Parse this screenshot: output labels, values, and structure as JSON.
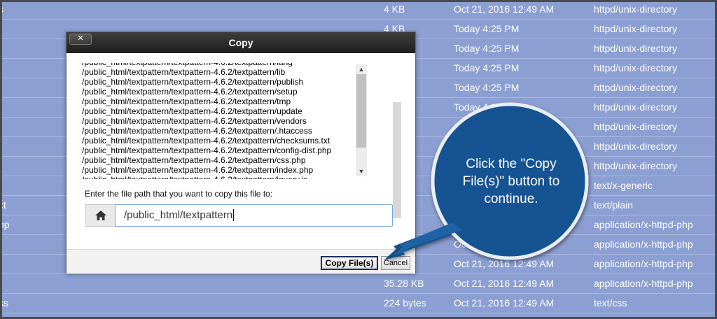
{
  "file_table": {
    "rows": [
      {
        "name": "s",
        "size": "4 KB",
        "date": "Oct 21, 2016 12:49 AM",
        "type": "httpd/unix-directory"
      },
      {
        "name": "",
        "size": "4 KB",
        "date": "Today 4:25 PM",
        "type": "httpd/unix-directory"
      },
      {
        "name": "",
        "size": "",
        "date": "Today 4:25 PM",
        "type": "httpd/unix-directory"
      },
      {
        "name": "",
        "size": "",
        "date": "Today 4:25 PM",
        "type": "httpd/unix-directory"
      },
      {
        "name": "",
        "size": "",
        "date": "Today 4:25 PM",
        "type": "httpd/unix-directory"
      },
      {
        "name": "",
        "size": "",
        "date": "Today 4:25 PM",
        "type": "httpd/unix-directory"
      },
      {
        "name": "",
        "size": "",
        "date": "Oct",
        "type": "httpd/unix-directory"
      },
      {
        "name": "",
        "size": "",
        "date": "",
        "type": "httpd/unix-directory"
      },
      {
        "name": "",
        "size": "",
        "date": "",
        "type": "httpd/unix-directory"
      },
      {
        "name": "",
        "size": "ytes",
        "date": "",
        "type": "text/x-generic"
      },
      {
        "name": "xt",
        "size": "",
        "date": "",
        "type": "text/plain"
      },
      {
        "name": "hp",
        "size": "B",
        "date": "",
        "type": "application/x-httpd-php"
      },
      {
        "name": "",
        "size": "",
        "date": "Oc",
        "type": "application/x-httpd-php"
      },
      {
        "name": "",
        "size": "B",
        "date": "Oct 21, 2016 12:49 AM",
        "type": "application/x-httpd-php"
      },
      {
        "name": "",
        "size": "35.28 KB",
        "date": "Oct 21, 2016 12:49 AM",
        "type": "application/x-httpd-php"
      },
      {
        "name": "ss",
        "size": "224 bytes",
        "date": "Oct 21, 2016 12:49 AM",
        "type": "text/css"
      }
    ]
  },
  "dialog": {
    "title": "Copy",
    "close_label": "✕",
    "files": [
      "/public_html/textpattern/textpattern-4.6.2/textpattern/lang",
      "/public_html/textpattern/textpattern-4.6.2/textpattern/lib",
      "/public_html/textpattern/textpattern-4.6.2/textpattern/publish",
      "/public_html/textpattern/textpattern-4.6.2/textpattern/setup",
      "/public_html/textpattern/textpattern-4.6.2/textpattern/tmp",
      "/public_html/textpattern/textpattern-4.6.2/textpattern/update",
      "/public_html/textpattern/textpattern-4.6.2/textpattern/vendors",
      "/public_html/textpattern/textpattern-4.6.2/textpattern/.htaccess",
      "/public_html/textpattern/textpattern-4.6.2/textpattern/checksums.txt",
      "/public_html/textpattern/textpattern-4.6.2/textpattern/config-dist.php",
      "/public_html/textpattern/textpattern-4.6.2/textpattern/css.php",
      "/public_html/textpattern/textpattern-4.6.2/textpattern/index.php",
      "/public_html/textpattern/textpattern-4.6.2/textpattern/jquery.js"
    ],
    "path_label": "Enter the file path that you want to copy this file to:",
    "path_value": "/public_html/textpattern",
    "copy_button": "Copy File(s)",
    "cancel_button": "Cancel"
  },
  "callout": {
    "text": "Click the \"Copy File(s)\" button to continue.",
    "color": "#1a5fa0"
  },
  "colors": {
    "row_background": "#8c9fd2",
    "dialog_header": "#2b2b2b"
  },
  "icons": {
    "home": "home-icon",
    "close": "close-icon",
    "scroll_up": "arrow-up-icon",
    "scroll_down": "arrow-down-icon"
  }
}
